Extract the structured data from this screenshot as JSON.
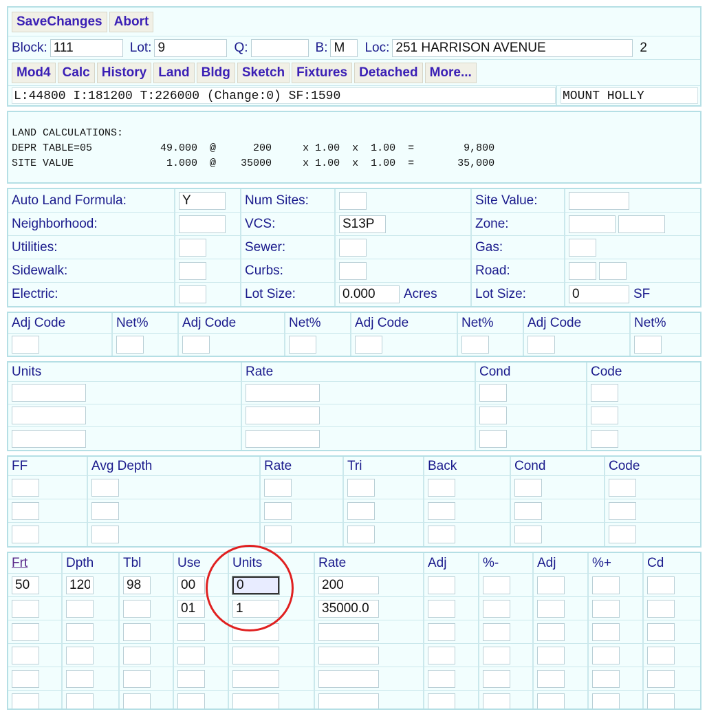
{
  "toolbar1": {
    "save": "SaveChanges",
    "abort": "Abort"
  },
  "id_row": {
    "block_label": "Block:",
    "block_value": "111",
    "lot_label": "Lot:",
    "lot_value": "9",
    "q_label": "Q:",
    "q_value": "",
    "b_label": "B:",
    "b_value": "M",
    "loc_label": "Loc:",
    "loc_value": "251 HARRISON AVENUE",
    "count": "2"
  },
  "toolbar2": [
    "Mod4",
    "Calc",
    "History",
    "Land",
    "Bldg",
    "Sketch",
    "Fixtures",
    "Detached",
    "More..."
  ],
  "summary": {
    "values": "L:44800 I:181200 T:226000 (Change:0) SF:1590",
    "town": "MOUNT HOLLY"
  },
  "calc_lines": [
    "LAND CALCULATIONS:",
    "DEPR TABLE=05           49.000  @      200     x 1.00  x  1.00  =        9,800",
    "SITE VALUE               1.000  @    35000     x 1.00  x  1.00  =       35,000"
  ],
  "land_attrs": {
    "auto_land_label": "Auto Land Formula:",
    "auto_land_value": "Y",
    "num_sites_label": "Num Sites:",
    "num_sites_value": "",
    "site_value_label": "Site Value:",
    "site_value_value": "",
    "neighborhood_label": "Neighborhood:",
    "neighborhood_value": "",
    "vcs_label": "VCS:",
    "vcs_value": "S13P",
    "zone_label": "Zone:",
    "utilities_label": "Utilities:",
    "sewer_label": "Sewer:",
    "gas_label": "Gas:",
    "sidewalk_label": "Sidewalk:",
    "curbs_label": "Curbs:",
    "road_label": "Road:",
    "electric_label": "Electric:",
    "lot_size_acres_label": "Lot Size:",
    "lot_size_acres_value": "0.000",
    "acres_unit": "Acres",
    "lot_size_sf_label": "Lot Size:",
    "lot_size_sf_value": "0",
    "sf_unit": "SF"
  },
  "adj_headers": [
    "Adj Code",
    "Net%",
    "Adj Code",
    "Net%",
    "Adj Code",
    "Net%",
    "Adj Code",
    "Net%"
  ],
  "units_headers": [
    "Units",
    "Rate",
    "Cond",
    "Code"
  ],
  "ff_headers": [
    "FF",
    "Avg Depth",
    "Rate",
    "Tri",
    "Back",
    "Cond",
    "Code"
  ],
  "detail_headers": [
    "Frt",
    "Dpth",
    "Tbl",
    "Use",
    "Units",
    "Rate",
    "Adj",
    "%-",
    "Adj",
    "%+",
    "Cd"
  ],
  "detail_rows": [
    [
      "50",
      "120",
      "98",
      "00",
      "0",
      "200",
      "",
      "",
      "",
      "",
      ""
    ],
    [
      "",
      "",
      "",
      "01",
      "1",
      "35000.0",
      "",
      "",
      "",
      "",
      ""
    ],
    [
      "",
      "",
      "",
      "",
      "",
      "",
      "",
      "",
      "",
      "",
      ""
    ],
    [
      "",
      "",
      "",
      "",
      "",
      "",
      "",
      "",
      "",
      "",
      ""
    ],
    [
      "",
      "",
      "",
      "",
      "",
      "",
      "",
      "",
      "",
      "",
      ""
    ],
    [
      "",
      "",
      "",
      "",
      "",
      "",
      "",
      "",
      "",
      "",
      ""
    ]
  ],
  "colors": {
    "panel_bg": "#f2fefe",
    "border": "#b5dfe5",
    "label": "#1a1a8c",
    "button_text": "#3a1fb5",
    "highlight_circle": "#e02020"
  }
}
